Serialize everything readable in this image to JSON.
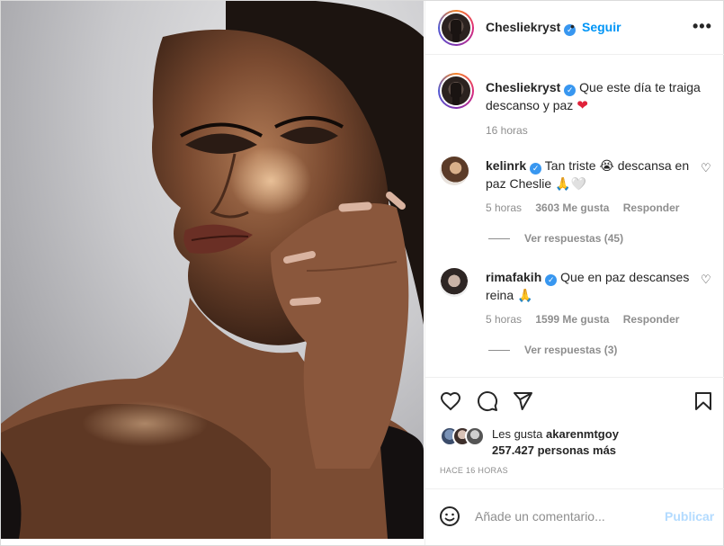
{
  "header": {
    "username": "Chesliekryst",
    "dot": "•",
    "follow_label": "Seguir",
    "more_label": "•••"
  },
  "caption": {
    "username": "Chesliekryst",
    "text": "Que este día te traiga descanso y paz",
    "emoji": "❤",
    "time": "16 horas"
  },
  "comments": [
    {
      "username": "kelinrk",
      "text": "Tan triste 😭 descansa en paz Cheslie 🙏🤍",
      "time": "5 horas",
      "likes": "3603 Me gusta",
      "reply_label": "Responder",
      "view_replies": "Ver respuestas (45)"
    },
    {
      "username": "rimafakih",
      "text": "Que en paz descanses reina 🙏",
      "time": "5 horas",
      "likes": "1599 Me gusta",
      "reply_label": "Responder",
      "view_replies": "Ver respuestas (3)"
    }
  ],
  "likes": {
    "prefix": "Les gusta ",
    "user": "akarenmtgoy",
    "suffix": "257.427 personas más"
  },
  "timestamp": "HACE 16 HORAS",
  "add_comment": {
    "placeholder": "Añade un comentario...",
    "publish_label": "Publicar"
  },
  "icons": {
    "like": "heart-outline-icon",
    "comment": "comment-bubble-icon",
    "share": "paper-plane-icon",
    "save": "bookmark-icon",
    "emoji": "smiley-face-icon",
    "verified": "verified-badge-icon"
  },
  "colors": {
    "link_blue": "#0095f6",
    "verified_blue": "#3897f0",
    "muted_text": "#8e8e8e",
    "publish_disabled": "#b3dbff",
    "heart_red": "#e0223a"
  }
}
